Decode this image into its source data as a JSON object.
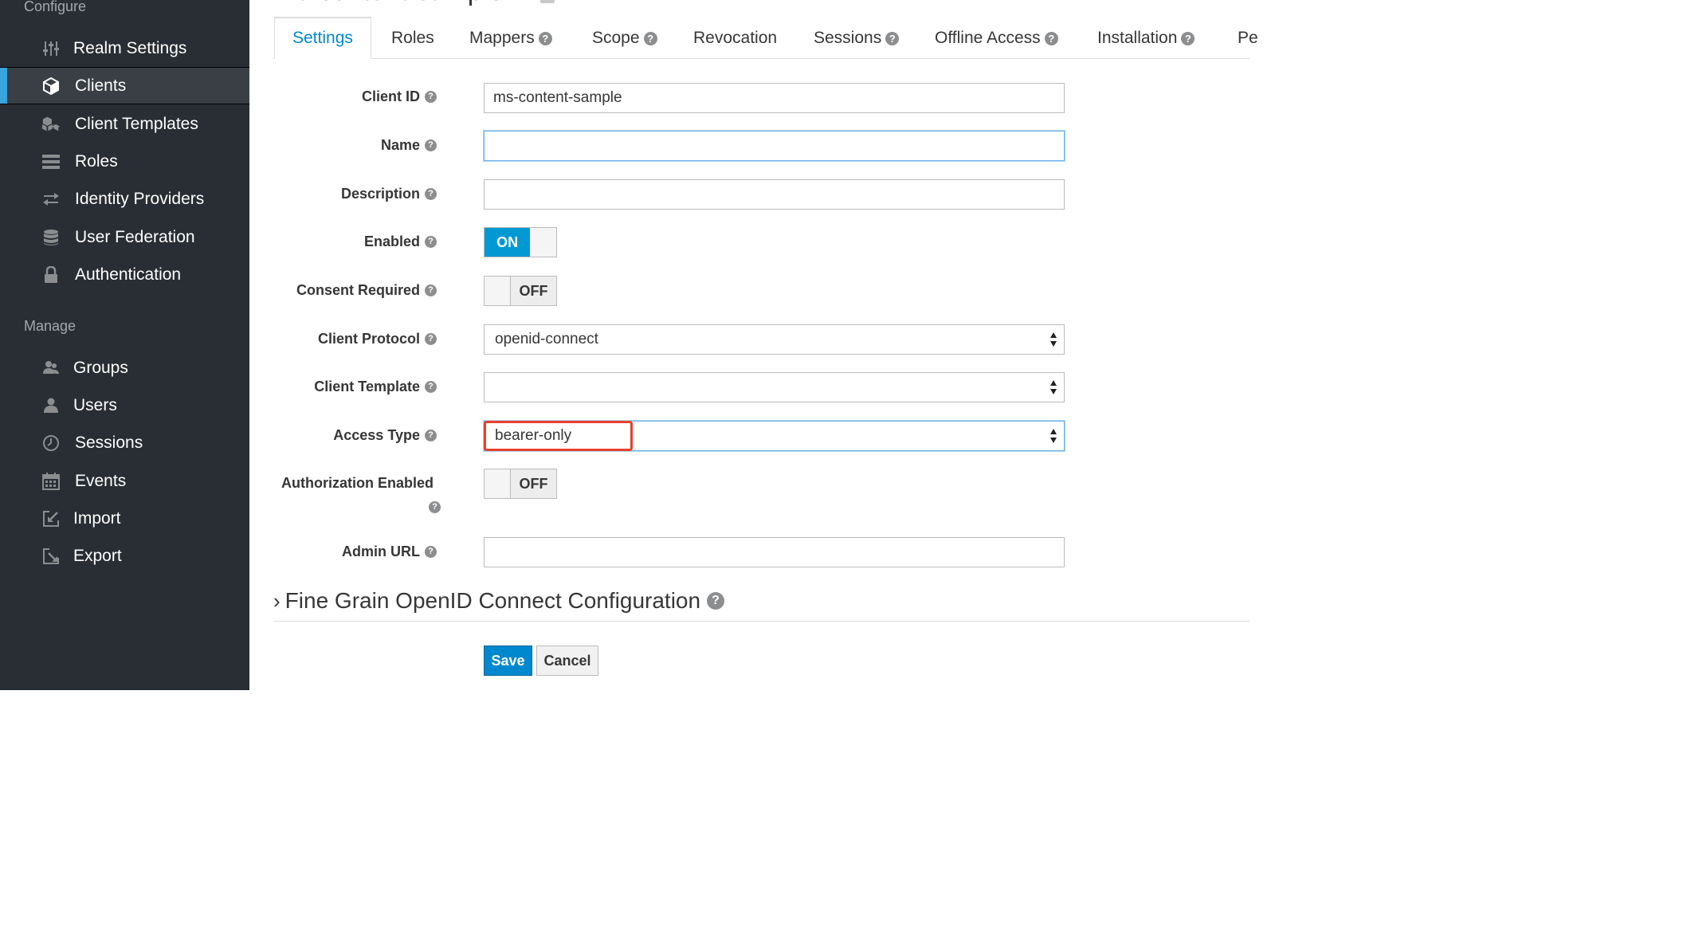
{
  "page": {
    "title_fragment": "ms-content-sample"
  },
  "sidebar": {
    "configure_label": "Configure",
    "manage_label": "Manage",
    "configure_items": [
      {
        "label": "Realm Settings",
        "icon": "sliders-icon"
      },
      {
        "label": "Clients",
        "icon": "cube-icon",
        "active": true
      },
      {
        "label": "Client Templates",
        "icon": "cubes-icon"
      },
      {
        "label": "Roles",
        "icon": "list-icon"
      },
      {
        "label": "Identity Providers",
        "icon": "exchange-icon"
      },
      {
        "label": "User Federation",
        "icon": "database-icon"
      },
      {
        "label": "Authentication",
        "icon": "lock-icon"
      }
    ],
    "manage_items": [
      {
        "label": "Groups",
        "icon": "users-icon"
      },
      {
        "label": "Users",
        "icon": "user-icon"
      },
      {
        "label": "Sessions",
        "icon": "clock-icon"
      },
      {
        "label": "Events",
        "icon": "calendar-icon"
      },
      {
        "label": "Import",
        "icon": "import-icon"
      },
      {
        "label": "Export",
        "icon": "export-icon"
      }
    ]
  },
  "tabs": [
    {
      "label": "Settings",
      "active": true,
      "help": false
    },
    {
      "label": "Roles",
      "help": false
    },
    {
      "label": "Mappers",
      "help": true
    },
    {
      "label": "Scope",
      "help": true
    },
    {
      "label": "Revocation",
      "help": false
    },
    {
      "label": "Sessions",
      "help": true
    },
    {
      "label": "Offline Access",
      "help": true
    },
    {
      "label": "Installation",
      "help": true
    },
    {
      "label": "Pe",
      "help": false
    }
  ],
  "form": {
    "client_id": {
      "label": "Client ID",
      "value": "ms-content-sample"
    },
    "name": {
      "label": "Name",
      "value": ""
    },
    "description": {
      "label": "Description",
      "value": ""
    },
    "enabled": {
      "label": "Enabled",
      "state": "ON"
    },
    "consent_required": {
      "label": "Consent Required",
      "state": "OFF"
    },
    "client_protocol": {
      "label": "Client Protocol",
      "value": "openid-connect"
    },
    "client_template": {
      "label": "Client Template",
      "value": ""
    },
    "access_type": {
      "label": "Access Type",
      "value": "bearer-only"
    },
    "authorization_enabled": {
      "label": "Authorization Enabled",
      "state": "OFF"
    },
    "admin_url": {
      "label": "Admin URL",
      "value": ""
    }
  },
  "section": {
    "fine_grain_label": "Fine Grain OpenID Connect Configuration"
  },
  "buttons": {
    "save": "Save",
    "cancel": "Cancel"
  },
  "colors": {
    "sidebar_bg": "#292e34",
    "accent_blue": "#0088ce",
    "toggle_on": "#0099d3",
    "highlight_red": "#e8402a"
  }
}
